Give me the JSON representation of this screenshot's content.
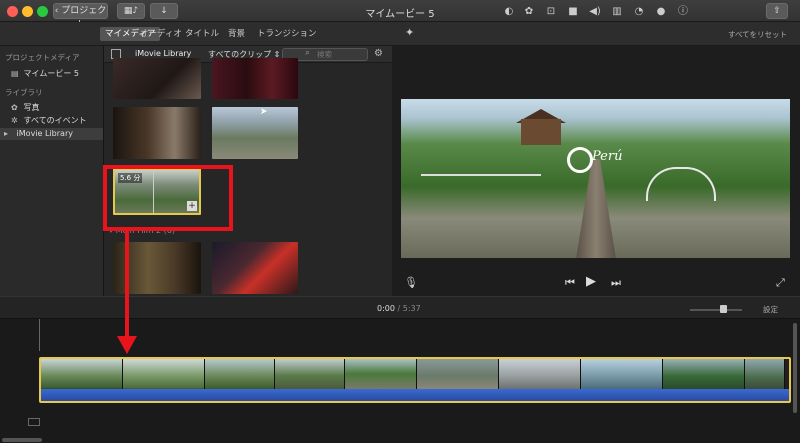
{
  "window": {
    "back_label": "プロジェクト",
    "title": "マイムービー 5"
  },
  "tabs": [
    {
      "label": "マイメディア",
      "active": true
    },
    {
      "label": "オーディオ",
      "active": false
    },
    {
      "label": "タイトル",
      "active": false
    },
    {
      "label": "背景",
      "active": false
    },
    {
      "label": "トランジション",
      "active": false
    }
  ],
  "viewer_toolbar": {
    "reset_label": "すべてをリセット",
    "icons": [
      "magic-wand-icon",
      "color-balance-icon",
      "palette-icon",
      "crop-icon",
      "camera-icon",
      "volume-icon",
      "equalizer-icon",
      "speed-icon",
      "filter-icon",
      "info-icon"
    ]
  },
  "sidebar": {
    "project_media_heading": "プロジェクトメディア",
    "project_item": "マイムービー 5",
    "library_heading": "ライブラリ",
    "items": [
      {
        "label": "写真"
      },
      {
        "label": "すべてのイベント"
      },
      {
        "label": "iMovie Library",
        "selected": true
      }
    ]
  },
  "browser": {
    "title": "iMovie Library",
    "filter": "すべてのクリップ",
    "search_placeholder": "検索",
    "selected_clip_duration": "5.6 分",
    "section_label": "Mein Film 2 (6)"
  },
  "timeline": {
    "current_time": "0:00",
    "separator": " / ",
    "total_time": "5:37",
    "settings_label": "設定"
  },
  "colors": {
    "accent_red": "#e8141c",
    "selection_yellow": "#e6c84a",
    "audio_blue": "#3a6ad0"
  }
}
